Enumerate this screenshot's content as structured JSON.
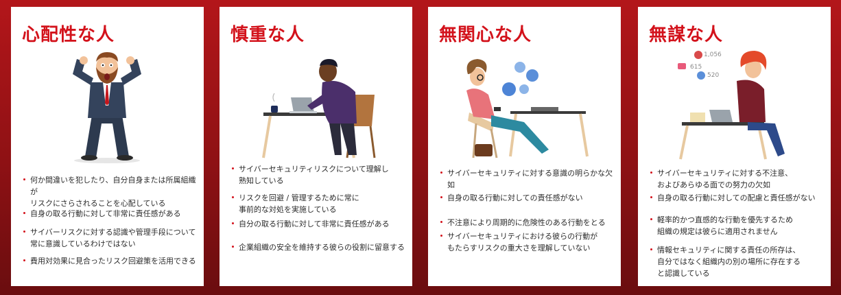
{
  "cards": [
    {
      "title": "心配性な人",
      "bullets": [
        "何か間違いを犯したり、自分自身または所属組織が\nリスクにさらされることを心配している",
        "自身の取る行動に対して非常に責任感がある",
        "サイバーリスクに対する認識や管理手段について\n常に意識しているわけではない",
        "費用対効果に見合ったリスク回避策を活用できる"
      ]
    },
    {
      "title": "慎重な人",
      "bullets": [
        "サイバーセキュリティリスクについて理解し\n熟知している",
        "リスクを回避 / 管理するために常に\n事前的な対処を実施している",
        "自分の取る行動に対して非常に責任感がある",
        "企業組織の安全を維持する彼らの役割に留意する"
      ]
    },
    {
      "title": "無関心な人",
      "bullets": [
        "サイバーセキュリティに対する意識の明らかな欠如",
        "自身の取る行動に対しての責任感がない",
        "不注意により周期的に危険性のある行動をとる",
        "サイバーセキュリティにおける彼らの行動が\nもたらすリスクの重大さを理解していない"
      ]
    },
    {
      "title": "無謀な人",
      "bullets": [
        "サイバーセキュリティに対する不注意、\nおよびあらゆる面での努力の欠如",
        "自身の取る行動に対しての配慮と責任感がない",
        "軽率的かつ直感的な行動を優先するため\n組織の規定は彼らに適用されません",
        "情報セキュリティに関する責任の所存は、\n自分ではなく組織内の別の場所に存在する\nと認識している"
      ],
      "social_stats": {
        "hearts": "1,056",
        "comments": "615",
        "likes": "520"
      }
    }
  ]
}
